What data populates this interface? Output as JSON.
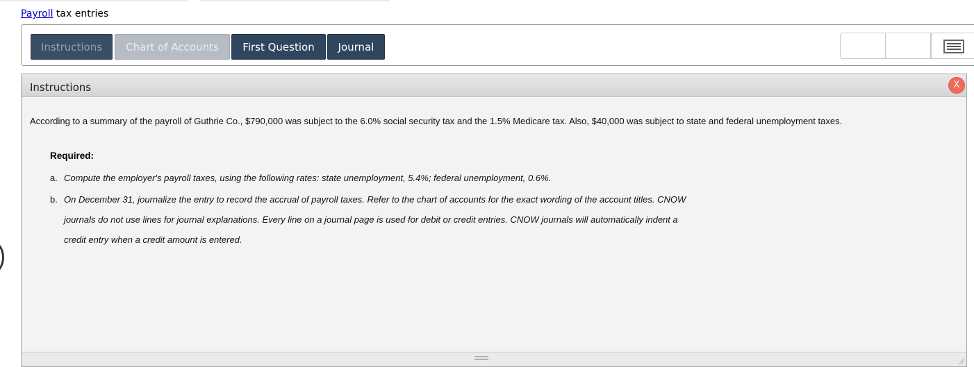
{
  "page": {
    "title_link": "Payroll",
    "title_rest": " tax entries"
  },
  "tabs": [
    {
      "label": "Instructions"
    },
    {
      "label": "Chart of Accounts"
    },
    {
      "label": "First Question"
    },
    {
      "label": "Journal"
    }
  ],
  "panel": {
    "title": "Instructions",
    "close_label": "X",
    "intro": "According to a summary of the payroll of Guthrie Co., $790,000 was subject to the 6.0% social security tax and the 1.5% Medicare tax. Also, $40,000 was subject to state and federal unemployment taxes.",
    "required_label": "Required:",
    "items": [
      {
        "letter": "a.",
        "text": "Compute the employer's payroll taxes, using the following rates: state unemployment, 5.4%; federal unemployment, 0.6%."
      },
      {
        "letter": "b.",
        "text": "On December 31, journalize the entry to record the accrual of payroll taxes. Refer to the chart of accounts for the exact wording of the account titles. CNOW journals do not use lines for journal explanations. Every line on a journal page is used for debit or credit entries. CNOW journals will automatically indent a credit entry when a credit amount is entered."
      }
    ]
  },
  "icons": {
    "menu": "menu-icon",
    "close": "close-icon",
    "resize": "resize-handle-icon"
  },
  "colors": {
    "tab_active": "#2f465e",
    "tab_disabled": "#b6bcc3",
    "close": "#f06a5c",
    "link": "#0000cc"
  }
}
